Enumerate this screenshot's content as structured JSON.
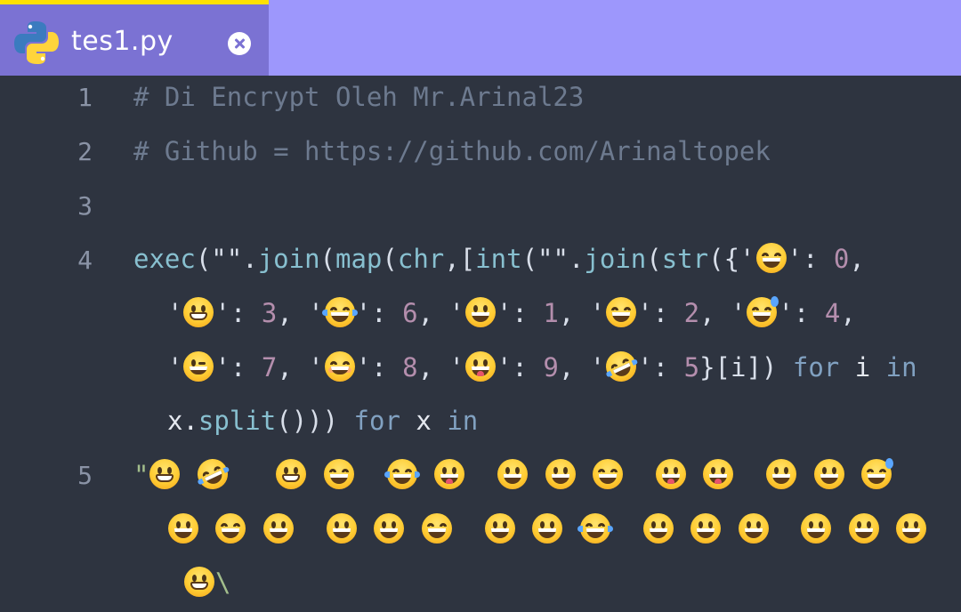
{
  "tab": {
    "title": "tes1.py",
    "icon": "python-logo-icon",
    "close_icon": "close-icon"
  },
  "colors": {
    "tabbar": "#9d97fc",
    "tab_active": "#7b72d3",
    "tab_indicator": "#ffe000",
    "editor_bg": "#2e3440"
  },
  "gutter": [
    "1",
    "2",
    "3",
    "4",
    "5"
  ],
  "code": {
    "line1": "# Di Encrypt Oleh Mr.Arinal23",
    "line2": "# Github = https://github.com/Arinaltopek",
    "line4": {
      "exec": "exec",
      "open1": "(\"\".",
      "join1": "join",
      "open2": "(",
      "map": "map",
      "open3": "(",
      "chr": "chr",
      "bracket": ",[",
      "int": "int",
      "open4": "(\"\".",
      "join2": "join",
      "open5": "(",
      "str": "str",
      "open6": "({'",
      "mapping": [
        {
          "emoji": "grinning-face",
          "value": "0"
        },
        {
          "emoji": "beaming-face",
          "value": "3"
        },
        {
          "emoji": "tears-of-joy-face",
          "value": "6"
        },
        {
          "emoji": "grinning-big-eyes-face",
          "value": "1"
        },
        {
          "emoji": "grinning-smiling-eyes-face",
          "value": "2"
        },
        {
          "emoji": "grinning-sweat-face",
          "value": "4"
        },
        {
          "emoji": "winking-face",
          "value": "7"
        },
        {
          "emoji": "smiling-eyes-face",
          "value": "8"
        },
        {
          "emoji": "tongue-face",
          "value": "9"
        },
        {
          "emoji": "rofl-face",
          "value": "5"
        }
      ],
      "close_map": "}[i])",
      "for1": "for",
      "i": "i",
      "in1": "in",
      "x_split": "x.",
      "split": "split",
      "close_split": "()))",
      "for2": "for",
      "x": "x",
      "in2": "in"
    },
    "line5": {
      "quote": "\"",
      "backslash": "\\"
    }
  }
}
